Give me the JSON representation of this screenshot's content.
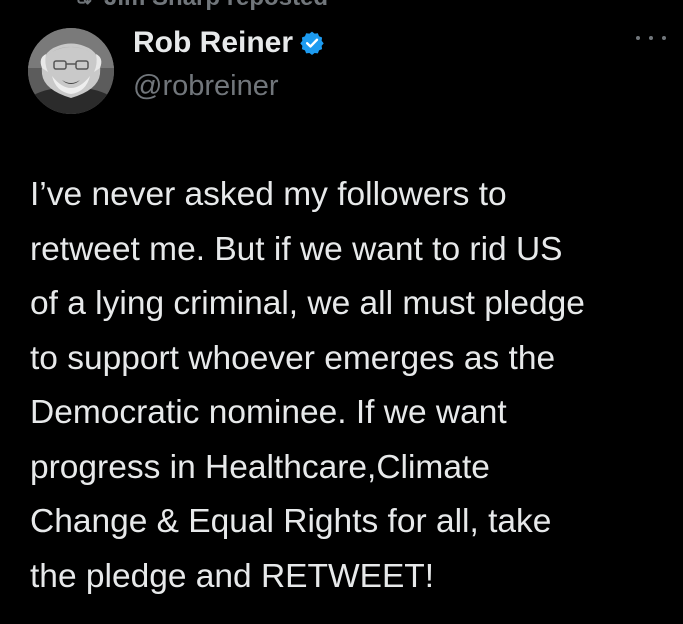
{
  "repost": {
    "text": "Jim Sharp reposted",
    "icon": "repost-icon"
  },
  "author": {
    "avatar_icon": "avatar-photo",
    "display_name": "Rob Reiner",
    "verified_icon": "verified-badge-icon",
    "verified_color": "#1d9bf0",
    "handle": "@robreiner"
  },
  "actions": {
    "more_icon": "more-options-icon"
  },
  "tweet": {
    "lines": [
      "I’ve never asked my followers to",
      "retweet me. But if we want to rid US",
      "of a lying criminal, we all must pledge",
      "to support whoever emerges as the",
      "Democratic nominee. If we want",
      "progress in Healthcare,Climate",
      "Change & Equal Rights for all, take",
      "the pledge and RETWEET!"
    ]
  },
  "colors": {
    "background": "#000000",
    "primary_text": "#e7e9ea",
    "secondary_text": "#71767b"
  }
}
